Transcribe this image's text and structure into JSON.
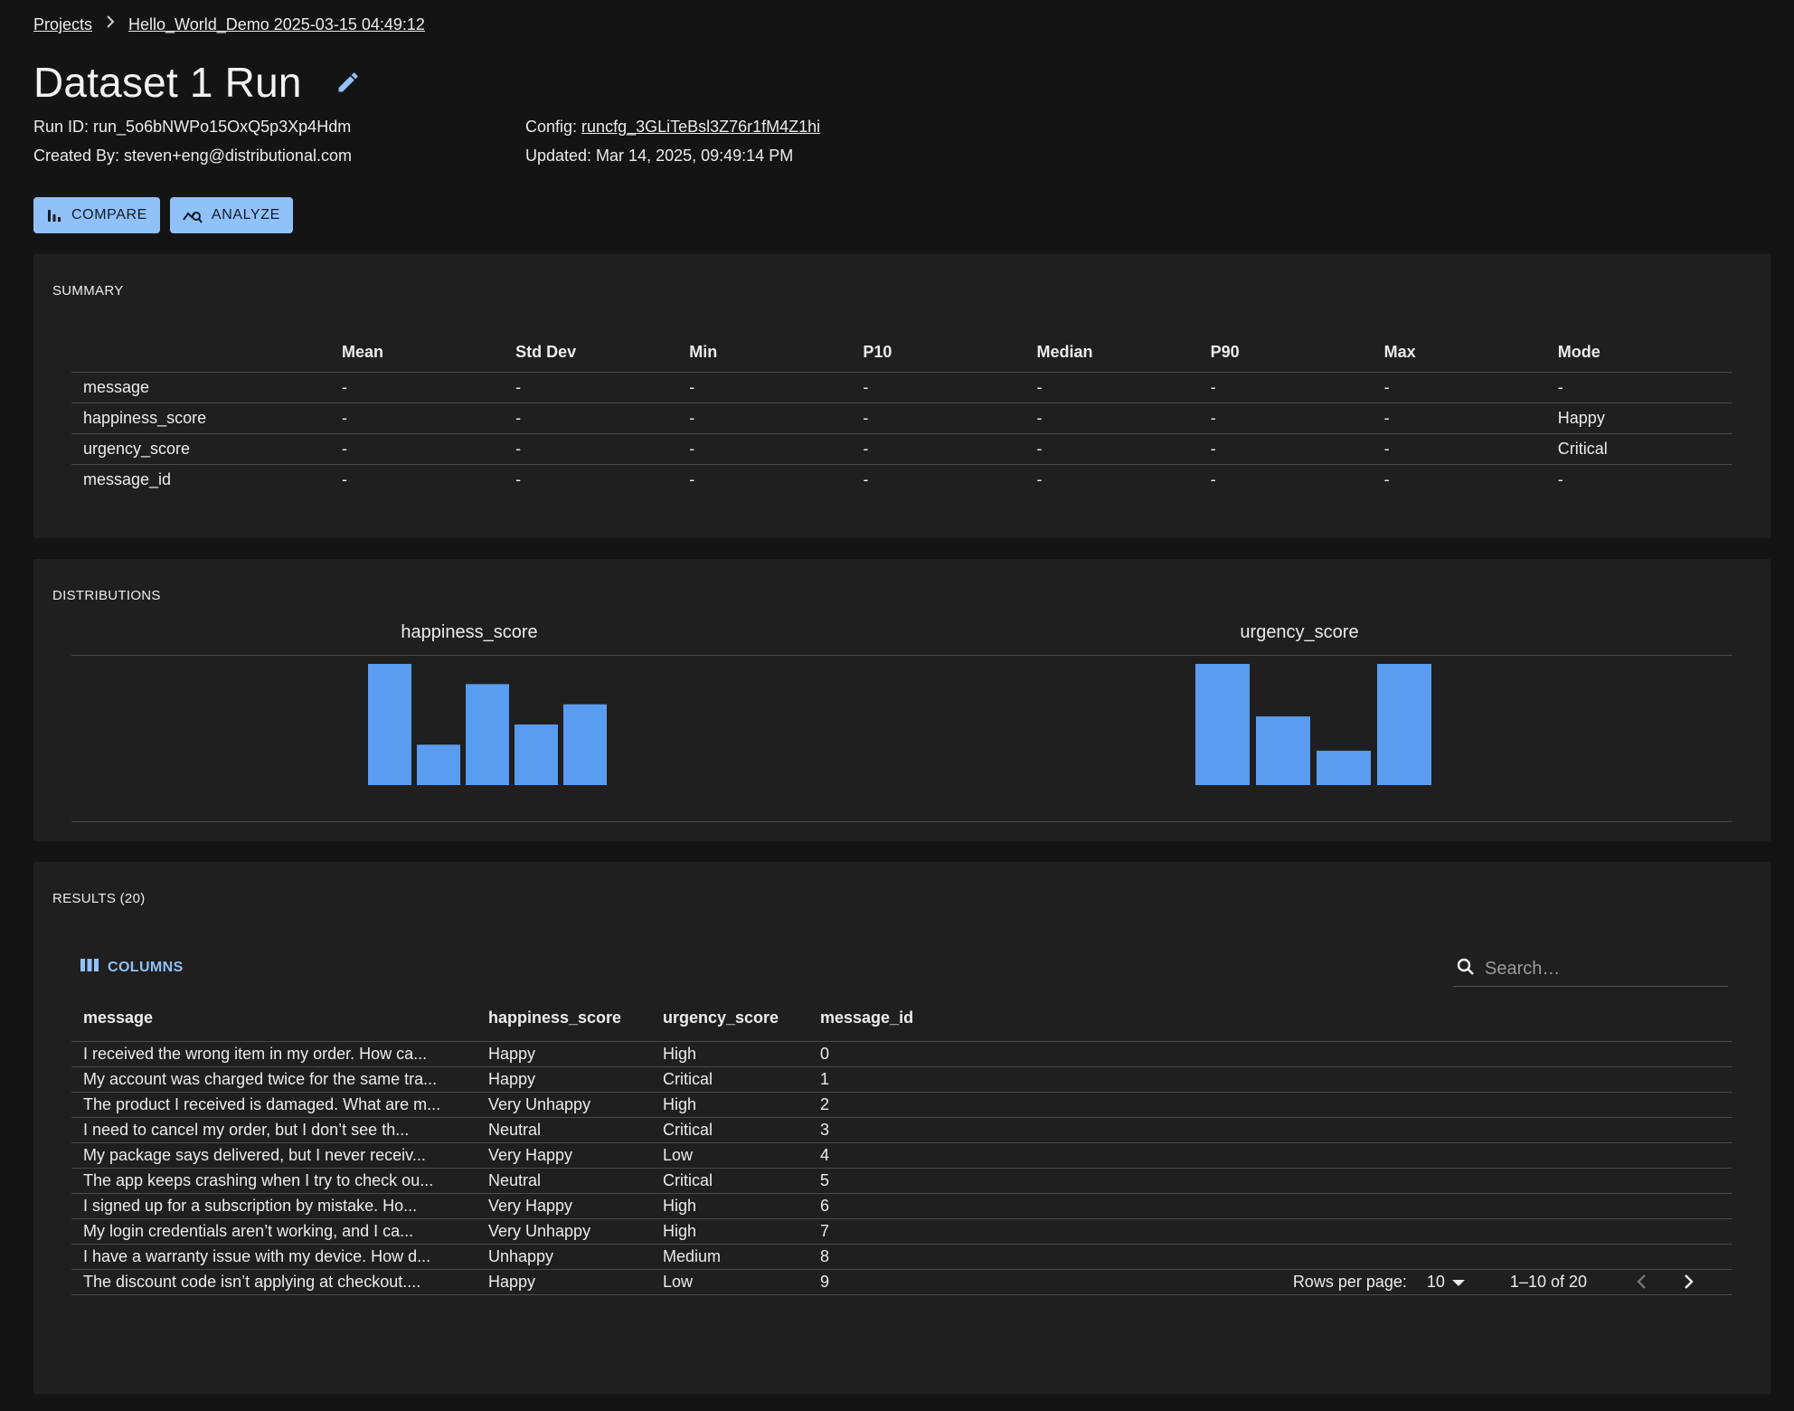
{
  "breadcrumb": {
    "root": "Projects",
    "current": "Hello_World_Demo 2025-03-15 04:49:12"
  },
  "page": {
    "title": "Dataset 1 Run"
  },
  "meta": {
    "run_id_label": "Run ID: ",
    "run_id_value": "run_5o6bNWPo15OxQ5p3Xp4Hdm",
    "created_by": "Created By: steven+eng@distributional.com",
    "config_label": "Config: ",
    "config_value": "runcfg_3GLiTeBsl3Z76r1fM4Z1hi",
    "updated": "Updated: Mar 14, 2025, 09:49:14 PM"
  },
  "actions": {
    "compare_label": "COMPARE",
    "analyze_label": "ANALYZE"
  },
  "colors": {
    "accent": "#90c2f9",
    "bar": "#5a9cef",
    "background": "#141414",
    "panel": "#1f1f1f"
  },
  "summary": {
    "title": "SUMMARY",
    "columns": [
      "",
      "Mean",
      "Std Dev",
      "Min",
      "P10",
      "Median",
      "P90",
      "Max",
      "Mode"
    ],
    "rows": [
      [
        "message",
        "-",
        "-",
        "-",
        "-",
        "-",
        "-",
        "-",
        "-"
      ],
      [
        "happiness_score",
        "-",
        "-",
        "-",
        "-",
        "-",
        "-",
        "-",
        "Happy"
      ],
      [
        "urgency_score",
        "-",
        "-",
        "-",
        "-",
        "-",
        "-",
        "-",
        "Critical"
      ],
      [
        "message_id",
        "-",
        "-",
        "-",
        "-",
        "-",
        "-",
        "-",
        "-"
      ]
    ]
  },
  "distributions": {
    "title": "DISTRIBUTIONS"
  },
  "chart_data": [
    {
      "type": "bar",
      "title": "happiness_score",
      "categories": [
        "",
        "",
        "",
        "",
        ""
      ],
      "values": [
        6,
        2,
        5,
        3,
        4
      ]
    },
    {
      "type": "bar",
      "title": "urgency_score",
      "categories": [
        "",
        "",
        "",
        ""
      ],
      "values": [
        6,
        3.4,
        1.7,
        6
      ]
    }
  ],
  "results": {
    "title": "RESULTS (20)",
    "columns_label": "COLUMNS",
    "search_placeholder": "Search…",
    "headers": [
      "message",
      "happiness_score",
      "urgency_score",
      "message_id"
    ],
    "rows": [
      [
        "I received the wrong item in my order. How ca...",
        "Happy",
        "High",
        "0"
      ],
      [
        "My account was charged twice for the same tra...",
        "Happy",
        "Critical",
        "1"
      ],
      [
        "The product I received is damaged. What are m...",
        "Very Unhappy",
        "High",
        "2"
      ],
      [
        "I need to cancel my order, but I don’t see th...",
        "Neutral",
        "Critical",
        "3"
      ],
      [
        "My package says delivered, but I never receiv...",
        "Very Happy",
        "Low",
        "4"
      ],
      [
        "The app keeps crashing when I try to check ou...",
        "Neutral",
        "Critical",
        "5"
      ],
      [
        "I signed up for a subscription by mistake. Ho...",
        "Very Happy",
        "High",
        "6"
      ],
      [
        "My login credentials aren’t working, and I ca...",
        "Very Unhappy",
        "High",
        "7"
      ],
      [
        "I have a warranty issue with my device. How d...",
        "Unhappy",
        "Medium",
        "8"
      ],
      [
        "The discount code isn’t applying at checkout....",
        "Happy",
        "Low",
        "9"
      ]
    ],
    "pagination": {
      "rows_per_page_label": "Rows per page:",
      "rows_per_page_value": "10",
      "range": "1–10 of 20"
    }
  }
}
